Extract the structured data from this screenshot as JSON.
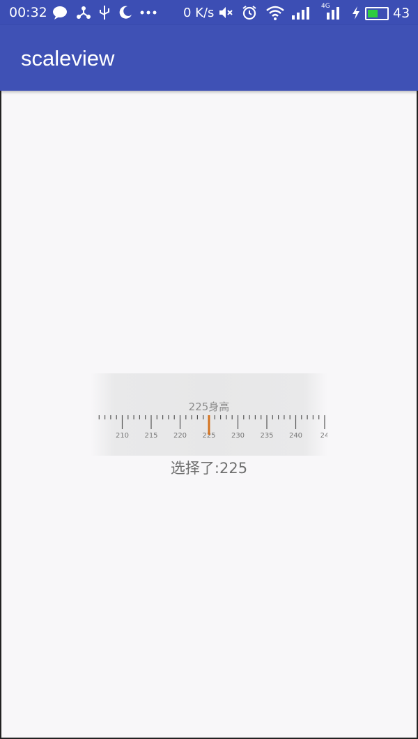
{
  "status_bar": {
    "time": "00:32",
    "net_speed": "0 K/s",
    "battery": "43",
    "icons_left": [
      "chat-icon",
      "share-icon",
      "usb-icon",
      "moon-icon",
      "more-icon"
    ],
    "icons_right": [
      "mute-icon",
      "alarm-icon",
      "wifi-icon",
      "signal-icon",
      "signal-4g-icon",
      "charging-icon",
      "battery-icon"
    ],
    "signal_label": "4G"
  },
  "app_bar": {
    "title": "scaleview"
  },
  "ruler": {
    "label": "225身高",
    "current_value": 225,
    "tick_labels": [
      "210",
      "215",
      "220",
      "225",
      "230",
      "235",
      "240",
      "24"
    ],
    "indicator_color": "#d4721f"
  },
  "result": {
    "text": "选择了:225"
  }
}
